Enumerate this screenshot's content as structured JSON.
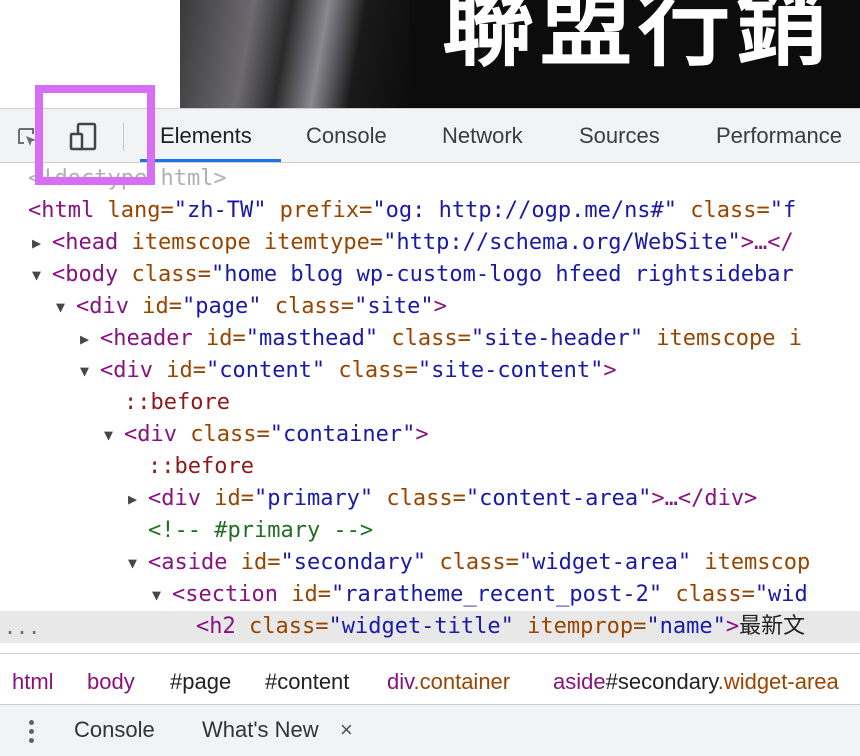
{
  "page_banner": {
    "text": "聯盟行銷"
  },
  "devtools": {
    "toolbar": {
      "icons": [
        "inspect-element-icon",
        "device-toolbar-icon"
      ],
      "tabs": [
        {
          "label": "Elements",
          "active": true
        },
        {
          "label": "Console"
        },
        {
          "label": "Network"
        },
        {
          "label": "Sources"
        },
        {
          "label": "Performance"
        }
      ]
    },
    "highlight_color": "#d76ef5",
    "accent_color": "#1a73e8",
    "dom_lines": [
      {
        "doctype": "<!doctype html>"
      },
      {
        "open": "<html",
        "a1": " lang=",
        "v1": "\"zh-TW\"",
        "a2": " prefix=",
        "v2": "\"og: http://ogp.me/ns#\"",
        "a3": " class=",
        "v3": "\"f"
      },
      {
        "toggle": "▶",
        "open": "<head",
        "a1": " itemscope",
        "a2": " itemtype=",
        "v2": "\"http://schema.org/WebSite\"",
        "close": ">…</"
      },
      {
        "toggle": "▼",
        "open": "<body",
        "a1": " class=",
        "v1": "\"home blog wp-custom-logo hfeed rightsidebar"
      },
      {
        "toggle": "▼",
        "open": "<div",
        "a1": " id=",
        "v1": "\"page\"",
        "a2": " class=",
        "v2": "\"site\"",
        "close": ">"
      },
      {
        "toggle": "▶",
        "open": "<header",
        "a1": " id=",
        "v1": "\"masthead\"",
        "a2": " class=",
        "v2": "\"site-header\"",
        "a3": " itemscope i"
      },
      {
        "toggle": "▼",
        "open": "<div",
        "a1": " id=",
        "v1": "\"content\"",
        "a2": " class=",
        "v2": "\"site-content\"",
        "close": ">"
      },
      {
        "pseudo": "::before"
      },
      {
        "toggle": "▼",
        "open": "<div",
        "a1": " class=",
        "v1": "\"container\"",
        "close": ">"
      },
      {
        "pseudo": "::before"
      },
      {
        "toggle": "▶",
        "open": "<div",
        "a1": " id=",
        "v1": "\"primary\"",
        "a2": " class=",
        "v2": "\"content-area\"",
        "close": ">…</div>"
      },
      {
        "comment": "<!-- #primary -->"
      },
      {
        "toggle": "▼",
        "open": "<aside",
        "a1": " id=",
        "v1": "\"secondary\"",
        "a2": " class=",
        "v2": "\"widget-area\"",
        "a3": " itemscop"
      },
      {
        "toggle": "▼",
        "open": "<section",
        "a1": " id=",
        "v1": "\"raratheme_recent_post-2\"",
        "a2": " class=",
        "v2": "\"wid"
      },
      {
        "open": "<h2",
        "a1": " class=",
        "v1": "\"widget-title\"",
        "a2": " itemprop=",
        "v2": "\"name\"",
        "close": ">",
        "text": "最新文"
      }
    ],
    "selected_row_prefix": "...",
    "breadcrumbs": [
      {
        "tag": "html"
      },
      {
        "tag": "body"
      },
      {
        "id": "#page"
      },
      {
        "id": "#content"
      },
      {
        "tag": "div",
        "cls": ".container"
      },
      {
        "tag": "aside",
        "id": "#secondary",
        "cls": ".widget-area"
      }
    ],
    "drawer": {
      "tabs": [
        {
          "label": "Console"
        },
        {
          "label": "What's New",
          "closable": true,
          "close_glyph": "×"
        }
      ]
    }
  }
}
